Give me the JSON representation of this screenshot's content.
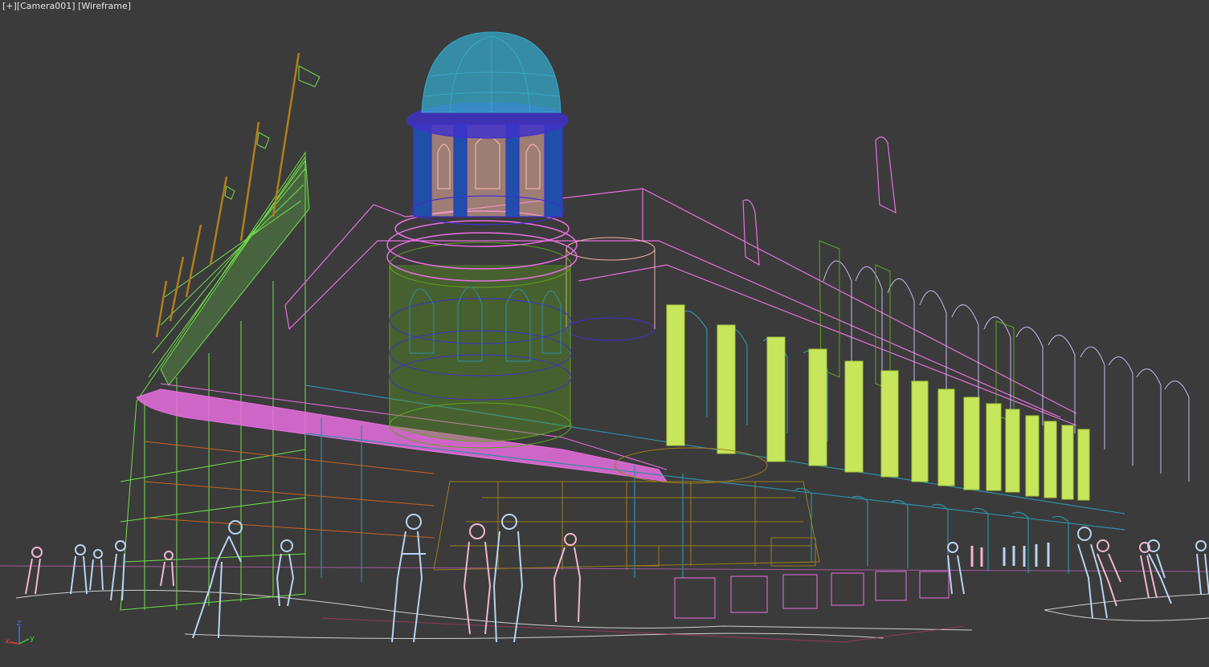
{
  "viewport": {
    "menu_label": "[+]",
    "camera_label": "[Camera001]",
    "shading_label": "[Wireframe]"
  },
  "axis_gizmo": {
    "x_label": "x",
    "y_label": "y",
    "z_label": "z"
  },
  "colors": {
    "background": "#3b3b3b",
    "dome": "#35a8c8",
    "tower_upper": "#3f31c9",
    "arch_windows": "#f0b4a6",
    "tower_lower": "#5fa61c",
    "roof_magenta": "#e86fe0",
    "columns": "#c8e65c",
    "arcade_teal": "#2e8fa6",
    "arches_outline": "#c6b8f0",
    "left_facade": "#6fe04a",
    "flag_poles": "#b27d1a",
    "base_ochre": "#9b7d1c",
    "people_blue": "#b8d4f2",
    "people_pink": "#f2b6d0",
    "ground_lines": "#e8e8e8"
  },
  "icons": [
    "axis-gizmo-icon"
  ]
}
